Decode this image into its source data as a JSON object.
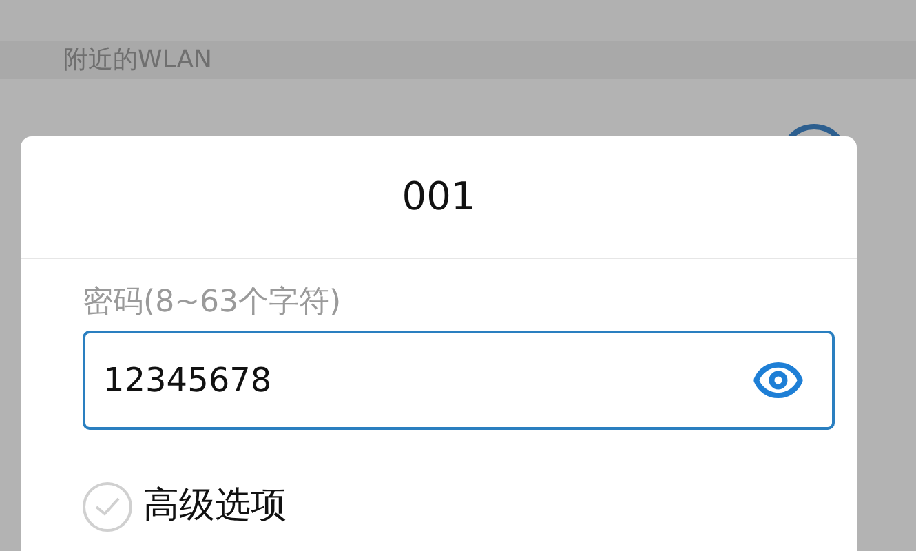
{
  "section_header": "附近的WLAN",
  "dialog": {
    "title": "001",
    "password": {
      "label": "密码(8~63个字符)",
      "value": "12345678",
      "visible": true
    },
    "advanced": {
      "label": "高级选项",
      "checked": false
    }
  }
}
